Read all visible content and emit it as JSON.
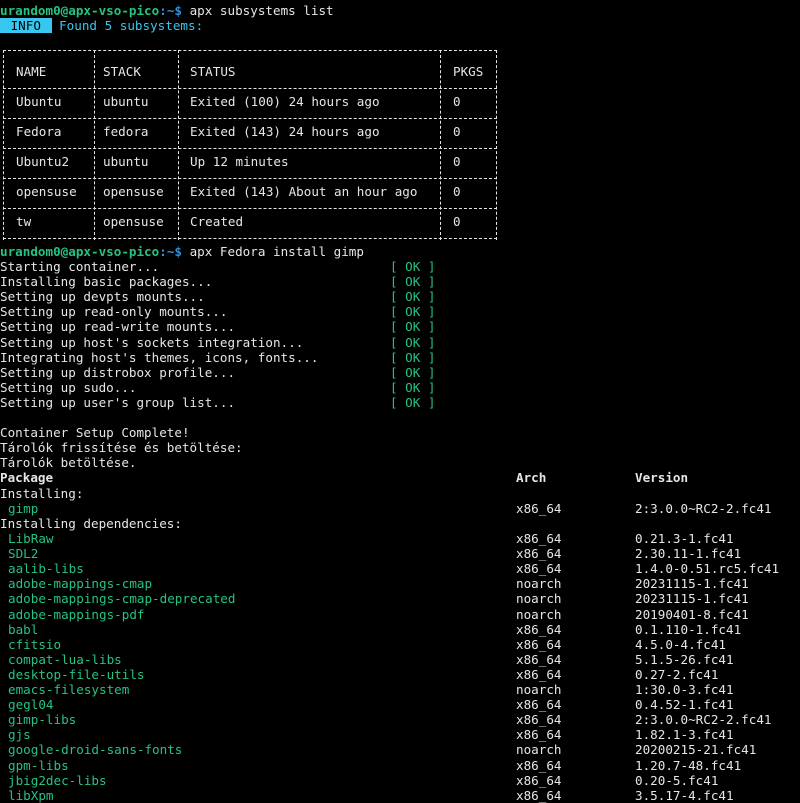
{
  "prompt1": {
    "user_host": "urandom0@apx-vso-pico",
    "sep": ":~$ ",
    "command": "apx subsystems list"
  },
  "info": {
    "badge": " INFO ",
    "message": "Found 5 subsystems:"
  },
  "subsystems": {
    "headers": [
      "NAME",
      "STACK",
      "STATUS",
      "PKGS"
    ],
    "rows": [
      [
        "Ubuntu",
        "ubuntu",
        "Exited (100) 24 hours ago",
        "0"
      ],
      [
        "Fedora",
        "fedora",
        "Exited (143) 24 hours ago",
        "0"
      ],
      [
        "Ubuntu2",
        "ubuntu",
        "Up 12 minutes",
        "0"
      ],
      [
        "opensuse",
        "opensuse",
        "Exited (143) About an hour ago",
        "0"
      ],
      [
        "tw",
        "opensuse",
        "Created",
        "0"
      ]
    ]
  },
  "prompt2": {
    "user_host": "urandom0@apx-vso-pico",
    "sep": ":~$ ",
    "command": "apx Fedora install gimp"
  },
  "setup_steps": [
    {
      "text": "Starting container...",
      "status": "[ OK ]"
    },
    {
      "text": "Installing basic packages...",
      "status": "[ OK ]"
    },
    {
      "text": "Setting up devpts mounts...",
      "status": "[ OK ]"
    },
    {
      "text": "Setting up read-only mounts...",
      "status": "[ OK ]"
    },
    {
      "text": "Setting up read-write mounts...",
      "status": "[ OK ]"
    },
    {
      "text": "Setting up host's sockets integration...",
      "status": "[ OK ]"
    },
    {
      "text": "Integrating host's themes, icons, fonts...",
      "status": "[ OK ]"
    },
    {
      "text": "Setting up distrobox profile...",
      "status": "[ OK ]"
    },
    {
      "text": "Setting up sudo...",
      "status": "[ OK ]"
    },
    {
      "text": "Setting up user's group list...",
      "status": "[ OK ]"
    }
  ],
  "messages": [
    "Container Setup Complete!",
    "Tárolók frissítése és betöltése:",
    "Tárolók betöltése."
  ],
  "pkg_headers": {
    "package": "Package",
    "arch": "Arch",
    "version": "Version"
  },
  "installing_label": "Installing:",
  "installing": [
    {
      "name": "gimp",
      "arch": "x86_64",
      "version": "2:3.0.0~RC2-2.fc41"
    }
  ],
  "deps_label": "Installing dependencies:",
  "dependencies": [
    {
      "name": "LibRaw",
      "arch": "x86_64",
      "version": "0.21.3-1.fc41"
    },
    {
      "name": "SDL2",
      "arch": "x86_64",
      "version": "2.30.11-1.fc41"
    },
    {
      "name": "aalib-libs",
      "arch": "x86_64",
      "version": "1.4.0-0.51.rc5.fc41"
    },
    {
      "name": "adobe-mappings-cmap",
      "arch": "noarch",
      "version": "20231115-1.fc41"
    },
    {
      "name": "adobe-mappings-cmap-deprecated",
      "arch": "noarch",
      "version": "20231115-1.fc41"
    },
    {
      "name": "adobe-mappings-pdf",
      "arch": "noarch",
      "version": "20190401-8.fc41"
    },
    {
      "name": "babl",
      "arch": "x86_64",
      "version": "0.1.110-1.fc41"
    },
    {
      "name": "cfitsio",
      "arch": "x86_64",
      "version": "4.5.0-4.fc41"
    },
    {
      "name": "compat-lua-libs",
      "arch": "x86_64",
      "version": "5.1.5-26.fc41"
    },
    {
      "name": "desktop-file-utils",
      "arch": "x86_64",
      "version": "0.27-2.fc41"
    },
    {
      "name": "emacs-filesystem",
      "arch": "noarch",
      "version": "1:30.0-3.fc41"
    },
    {
      "name": "gegl04",
      "arch": "x86_64",
      "version": "0.4.52-1.fc41"
    },
    {
      "name": "gimp-libs",
      "arch": "x86_64",
      "version": "2:3.0.0~RC2-2.fc41"
    },
    {
      "name": "gjs",
      "arch": "x86_64",
      "version": "1.82.1-3.fc41"
    },
    {
      "name": "google-droid-sans-fonts",
      "arch": "noarch",
      "version": "20200215-21.fc41"
    },
    {
      "name": "gpm-libs",
      "arch": "x86_64",
      "version": "1.20.7-48.fc41"
    },
    {
      "name": "jbig2dec-libs",
      "arch": "x86_64",
      "version": "0.20-5.fc41"
    },
    {
      "name": "libXpm",
      "arch": "x86_64",
      "version": "3.5.17-4.fc41"
    }
  ],
  "colors": {
    "background": "#000000",
    "green": "#26c281",
    "cyan": "#37c6ee",
    "path_blue": "#2f8fd8"
  }
}
